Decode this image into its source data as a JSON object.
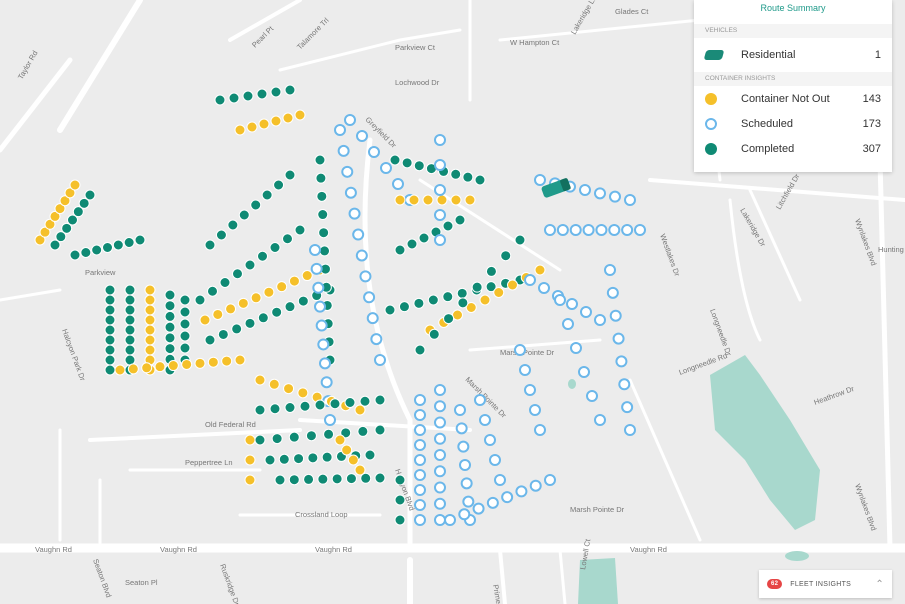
{
  "route_summary": {
    "title": "Route Summary",
    "vehicles_header": "VEHICLES",
    "vehicles": [
      {
        "label": "Residential",
        "count": "1",
        "icon": "garbage-truck-icon",
        "color": "#1a8a78"
      }
    ],
    "insights_header": "CONTAINER INSIGHTS",
    "insights": [
      {
        "label": "Container Not Out",
        "count": "143",
        "icon": "exclamation-icon",
        "color": "#f5c02a"
      },
      {
        "label": "Scheduled",
        "count": "173",
        "icon": "clock-icon",
        "color": "#6bb7ea"
      },
      {
        "label": "Completed",
        "count": "307",
        "icon": "check-icon",
        "color": "#0f8a74"
      }
    ]
  },
  "fleet_insights": {
    "badge": "62",
    "label": "FLEET INSIGHTS",
    "icon": "chevron-up-icon"
  },
  "streets": [
    "Taylor Rd",
    "Pearl Pt",
    "Talamore Trl",
    "Parkview Ct",
    "Greyfield Dr",
    "Lochwood Dr",
    "W Hampton Ct",
    "Lakeridge Ln",
    "Glades Ct",
    "Parkview",
    "Halcyon Park Dr",
    "Old Federal Rd",
    "Peppertree Ln",
    "Crossland Loop",
    "Vaughn Rd",
    "Vaughn Rd",
    "Vaughn Rd",
    "Vaughn Rd",
    "Seaton Blvd",
    "Seaton Pl",
    "Ruskridge Dr",
    "Halcyon Blvd",
    "Marsh Pointe Dr",
    "Marsh Pointe Dr",
    "Marsh Pointe Dr",
    "Westlakes Dr",
    "Lakeridge Dr",
    "Longneedle Dr",
    "Longneedle Rd",
    "Heathrow Dr",
    "Wynlakes Blvd",
    "Wynlakes Blvd",
    "Litchfield Dr",
    "Hunting",
    "Lowell Ct",
    "Prime"
  ]
}
